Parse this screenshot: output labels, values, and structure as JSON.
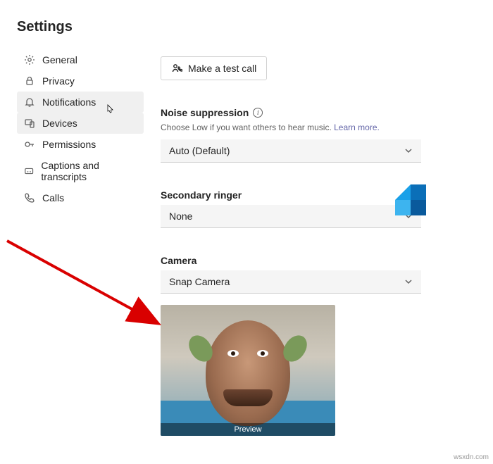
{
  "header": {
    "title": "Settings"
  },
  "sidebar": {
    "items": [
      {
        "label": "General"
      },
      {
        "label": "Privacy"
      },
      {
        "label": "Notifications"
      },
      {
        "label": "Devices"
      },
      {
        "label": "Permissions"
      },
      {
        "label": "Captions and transcripts"
      },
      {
        "label": "Calls"
      }
    ]
  },
  "testCall": {
    "label": "Make a test call"
  },
  "noise": {
    "title": "Noise suppression",
    "desc_prefix": "Choose Low if you want others to hear music. ",
    "learn_more": "Learn more.",
    "selected": "Auto (Default)"
  },
  "ringer": {
    "title": "Secondary ringer",
    "selected": "None"
  },
  "camera": {
    "title": "Camera",
    "selected": "Snap Camera",
    "preview_label": "Preview"
  },
  "watermark": "wsxdn.com"
}
